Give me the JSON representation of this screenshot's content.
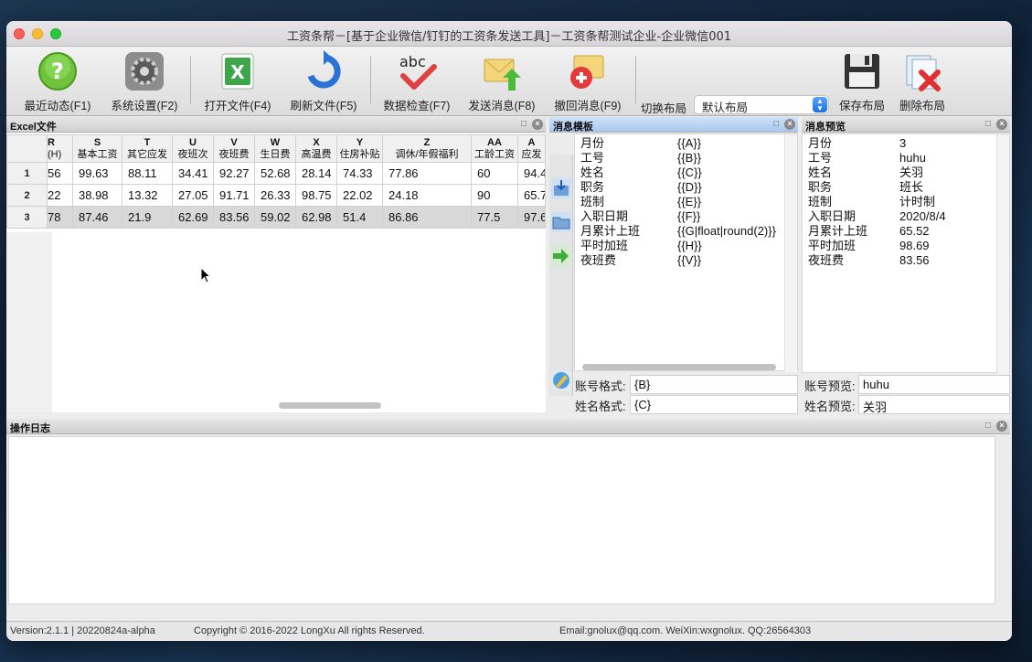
{
  "window": {
    "title": "工资条帮－[基于企业微信/钉钉的工资条发送工具]－工资条帮测试企业-企业微信001"
  },
  "toolbar": {
    "recent": "最近动态(F1)",
    "settings": "系统设置(F2)",
    "open_file": "打开文件(F4)",
    "refresh_file": "刷新文件(F5)",
    "data_check": "数据检查(F7)",
    "send_msg": "发送消息(F8)",
    "revoke_msg": "撤回消息(F9)",
    "switch_layout_label": "切换布局",
    "layout_value": "默认布局",
    "save_layout": "保存布局",
    "delete_layout": "删除布局"
  },
  "excel_panel": {
    "title": "Excel文件",
    "columns": [
      {
        "letter": "R",
        "name": "(H)"
      },
      {
        "letter": "S",
        "name": "基本工资"
      },
      {
        "letter": "T",
        "name": "其它应发"
      },
      {
        "letter": "U",
        "name": "夜班次"
      },
      {
        "letter": "V",
        "name": "夜班费"
      },
      {
        "letter": "W",
        "name": "生日费"
      },
      {
        "letter": "X",
        "name": "高温费"
      },
      {
        "letter": "Y",
        "name": "住房补贴"
      },
      {
        "letter": "Z",
        "name": "调休/年假福利"
      },
      {
        "letter": "AA",
        "name": "工龄工资"
      },
      {
        "letter": "A",
        "name": "应发"
      }
    ],
    "rows": [
      {
        "num": "1",
        "cells": [
          "56",
          "99.63",
          "88.11",
          "34.41",
          "92.27",
          "52.68",
          "28.14",
          "74.33",
          "77.86",
          "60",
          "94.4"
        ]
      },
      {
        "num": "2",
        "cells": [
          "22",
          "38.98",
          "13.32",
          "27.05",
          "91.71",
          "26.33",
          "98.75",
          "22.02",
          "24.18",
          "90",
          "65.7"
        ]
      },
      {
        "num": "3",
        "cells": [
          "78",
          "87.46",
          "21.9",
          "62.69",
          "83.56",
          "59.02",
          "62.98",
          "51.4",
          "86.86",
          "77.5",
          "97.6"
        ]
      }
    ]
  },
  "template_panel": {
    "title": "消息模板",
    "items": [
      {
        "k": "月份",
        "v": "{{A}}"
      },
      {
        "k": "工号",
        "v": "{{B}}"
      },
      {
        "k": "姓名",
        "v": "{{C}}"
      },
      {
        "k": "职务",
        "v": "{{D}}"
      },
      {
        "k": "班制",
        "v": "{{E}}"
      },
      {
        "k": "入职日期",
        "v": "{{F}}"
      },
      {
        "k": "月累计上班",
        "v": "{{G|float|round(2)}}"
      },
      {
        "k": "平时加班",
        "v": "{{H}}"
      },
      {
        "k": "夜班费",
        "v": "{{V}}"
      }
    ],
    "account_label": "账号格式:",
    "account_value": "{B}",
    "name_label": "姓名格式:",
    "name_value": "{C}"
  },
  "preview_panel": {
    "title": "消息预览",
    "items": [
      {
        "k": "月份",
        "v": "3"
      },
      {
        "k": "工号",
        "v": "huhu"
      },
      {
        "k": "姓名",
        "v": "关羽"
      },
      {
        "k": "职务",
        "v": "班长"
      },
      {
        "k": "班制",
        "v": "计时制"
      },
      {
        "k": "入职日期",
        "v": "2020/8/4"
      },
      {
        "k": "月累计上班",
        "v": "65.52"
      },
      {
        "k": "平时加班",
        "v": "98.69"
      },
      {
        "k": "夜班费",
        "v": "83.56"
      }
    ],
    "account_label": "账号预览:",
    "account_value": "huhu",
    "name_label": "姓名预览:",
    "name_value": "关羽"
  },
  "log_panel": {
    "title": "操作日志"
  },
  "status": {
    "version": "Version:2.1.1 | 20220824a-alpha",
    "copyright": "Copyright © 2016-2022 LongXu All rights Reserved.",
    "contact": "Email:gnolux@qq.com.  WeiXin:wxgnolux. QQ:26564303"
  },
  "colors": {
    "accent": "#1a6fe6",
    "selected_row": "#d8d8d8",
    "active_panel": "#a8c8ee"
  }
}
